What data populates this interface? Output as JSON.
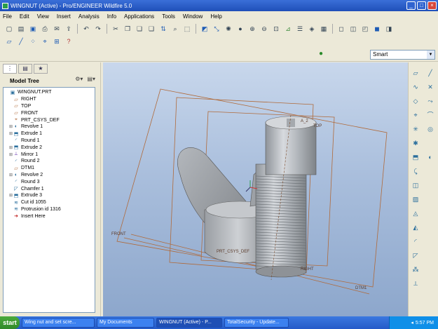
{
  "window": {
    "title": "WINGNUT (Active) - Pro/ENGINEER Wildfire 5.0"
  },
  "menu": [
    "File",
    "Edit",
    "View",
    "Insert",
    "Analysis",
    "Info",
    "Applications",
    "Tools",
    "Window",
    "Help"
  ],
  "filter": {
    "selected": "Smart"
  },
  "model_tree": {
    "title": "Model Tree",
    "items": [
      {
        "label": "WINGNUT.PRT",
        "icon": "part-icon",
        "indent": 0,
        "expandable": false
      },
      {
        "label": "RIGHT",
        "icon": "datum-plane-icon",
        "indent": 1,
        "expandable": false
      },
      {
        "label": "TOP",
        "icon": "datum-plane-icon",
        "indent": 1,
        "expandable": false
      },
      {
        "label": "FRONT",
        "icon": "datum-plane-icon",
        "indent": 1,
        "expandable": false
      },
      {
        "label": "PRT_CSYS_DEF",
        "icon": "csys-icon",
        "indent": 1,
        "expandable": false
      },
      {
        "label": "Revolve 1",
        "icon": "revolve-icon",
        "indent": 1,
        "expandable": true
      },
      {
        "label": "Extrude 1",
        "icon": "extrude-icon",
        "indent": 1,
        "expandable": true
      },
      {
        "label": "Round 1",
        "icon": "round-icon",
        "indent": 1,
        "expandable": false
      },
      {
        "label": "Extrude 2",
        "icon": "extrude-icon",
        "indent": 1,
        "expandable": true
      },
      {
        "label": "Mirror 1",
        "icon": "mirror-icon",
        "indent": 1,
        "expandable": true
      },
      {
        "label": "Round 2",
        "icon": "round-icon",
        "indent": 1,
        "expandable": false
      },
      {
        "label": "DTM1",
        "icon": "datum-plane-icon",
        "indent": 1,
        "expandable": false
      },
      {
        "label": "Revolve 2",
        "icon": "revolve-icon",
        "indent": 1,
        "expandable": true
      },
      {
        "label": "Round 3",
        "icon": "round-icon",
        "indent": 1,
        "expandable": false
      },
      {
        "label": "Chamfer 1",
        "icon": "chamfer-icon",
        "indent": 1,
        "expandable": false
      },
      {
        "label": "Extrude 3",
        "icon": "extrude-icon",
        "indent": 1,
        "expandable": true
      },
      {
        "label": "Cut id 1055",
        "icon": "cosmetic-thread-icon",
        "indent": 1,
        "expandable": false
      },
      {
        "label": "Protrusion id 1316",
        "icon": "cosmetic-thread-icon",
        "indent": 1,
        "expandable": false
      },
      {
        "label": "Insert Here",
        "icon": "insert-arrow-icon",
        "indent": 1,
        "expandable": false
      }
    ]
  },
  "viewport": {
    "datum_labels": {
      "top": "TOP",
      "front": "FRONT",
      "right": "RIGHT",
      "dtm1": "DTM1",
      "a2": "A_2",
      "csys": "PRT_CSYS_DEF"
    }
  },
  "taskbar": {
    "start": "start",
    "tasks": [
      {
        "label": "Wing nut and set scre...",
        "active": false
      },
      {
        "label": "My Documents",
        "active": false
      },
      {
        "label": "WINGNUT (Active) - P...",
        "active": true
      },
      {
        "label": "TotalSecurity - Update...",
        "active": false
      }
    ],
    "clock": "5:57 PM"
  },
  "colors": {
    "title_bar": "#245ac8",
    "viewport_top": "#c8d7ec",
    "viewport_bottom": "#8da7cc",
    "datum_plane": "#b06a3a"
  }
}
